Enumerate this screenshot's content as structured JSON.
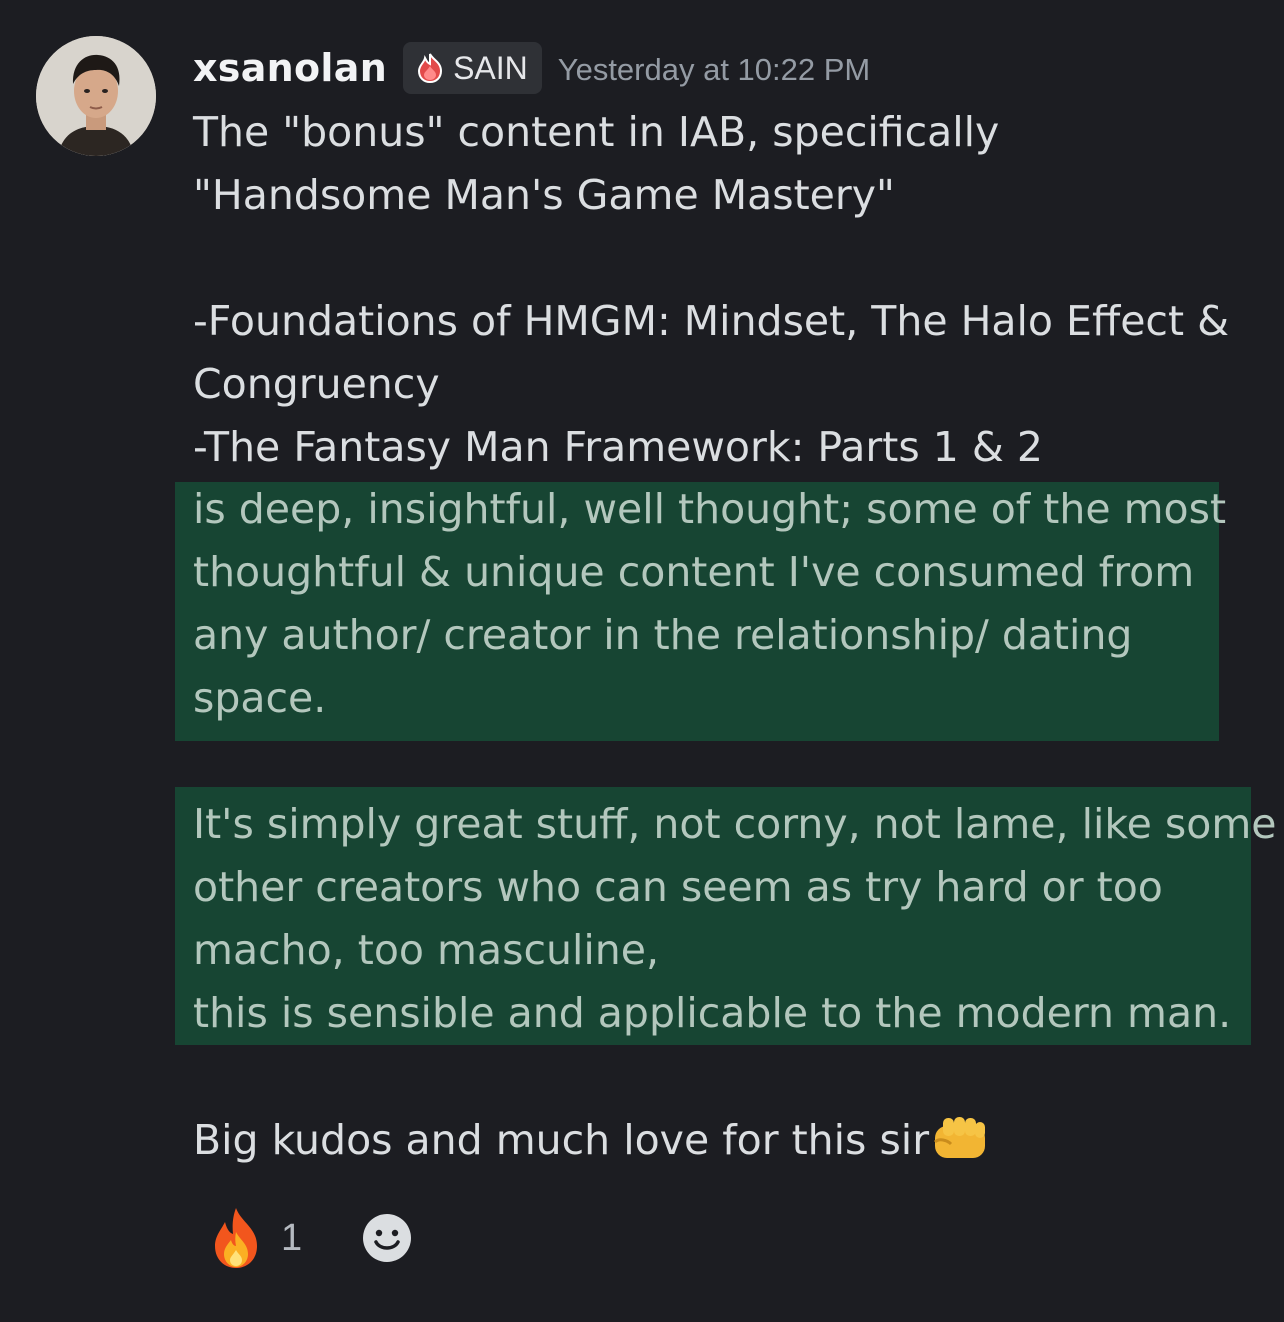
{
  "message": {
    "username": "xsanolan",
    "tag": {
      "label": "SAIN",
      "icon": "red-flame-badge-icon"
    },
    "timestamp": "Yesterday at 10:22 PM",
    "lines_top": [
      "The \"bonus\" content in IAB, specifically",
      "\"Handsome Man's Game Mastery\"",
      "",
      "-Foundations of HMGM: Mindset, The Halo Effect &",
      "Congruency",
      "-The Fantasy Man Framework: Parts 1 & 2"
    ],
    "highlight_1": [
      "is deep, insightful, well thought; some of the most",
      "thoughtful & unique content I've consumed from",
      "any author/ creator in the relationship/ dating",
      "space."
    ],
    "highlight_2": [
      "It's simply great stuff, not corny, not lame, like some",
      "other creators who can seem as try hard or too",
      "macho, too masculine,",
      "this is sensible and applicable to the modern man."
    ],
    "closing": "Big kudos and much love for this sir",
    "closing_emoji": "fist-bump-icon"
  },
  "reactions": [
    {
      "emoji": "fire-icon",
      "count": "1"
    }
  ],
  "add_reaction_icon": "smiley-add-reaction-icon",
  "colors": {
    "background": "#1c1d22",
    "highlight": "#174533",
    "text": "#dbdee1",
    "muted": "#949ba4"
  }
}
